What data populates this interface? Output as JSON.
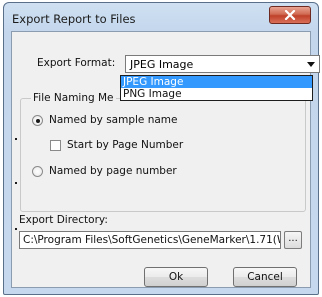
{
  "window": {
    "title": "Export Report to Files",
    "close_icon": "close-icon"
  },
  "export_format": {
    "label": "Export Format:",
    "value": "JPEG Image",
    "options": [
      "JPEG Image",
      "PNG Image"
    ],
    "highlighted_option": "JPEG Image"
  },
  "file_naming": {
    "legend": "File Naming Me",
    "named_by_sample": "Named by sample name",
    "start_by_page": "Start by Page Number",
    "named_by_page": "Named by page number"
  },
  "export_directory": {
    "label": "Export Directory:",
    "value": "C:\\Program Files\\SoftGenetics\\GeneMarker\\1.71(W",
    "browse_label": "..."
  },
  "buttons": {
    "ok": "Ok",
    "cancel": "Cancel"
  },
  "colors": {
    "title_bar": "#c3d6ec",
    "close_button": "#c0412a",
    "selection": "#3399ff"
  }
}
